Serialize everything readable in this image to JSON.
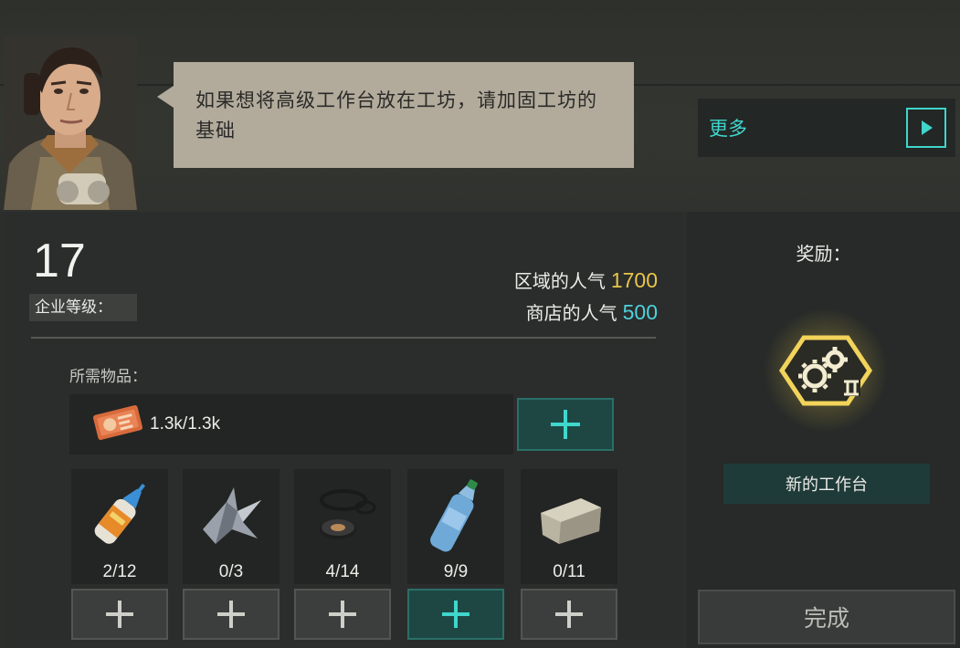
{
  "npc": {
    "dialog": "如果想将高级工作台放在工坊，请加固工坊的基础"
  },
  "more": {
    "label": "更多"
  },
  "level": {
    "value": "17",
    "label": "企业等级："
  },
  "popularity": {
    "region_label": "区域的人气",
    "region_value": "1700",
    "shop_label": "商店的人气",
    "shop_value": "500",
    "region_color": "#e9c54a",
    "shop_color": "#4fd1dc"
  },
  "requirements": {
    "label": "所需物品：",
    "money": {
      "icon": "money-voucher-icon",
      "amount": "1.3k/1.3k"
    },
    "items": [
      {
        "icon": "glue-icon",
        "count": "2/12"
      },
      {
        "icon": "scrap-metal-icon",
        "count": "0/3"
      },
      {
        "icon": "rubber-seal-icon",
        "count": "4/14"
      },
      {
        "icon": "water-bottle-icon",
        "count": "9/9"
      },
      {
        "icon": "stone-block-icon",
        "count": "0/11"
      }
    ]
  },
  "reward": {
    "title": "奖励：",
    "icon": "workbench-gears-icon",
    "name": "新的工作台"
  },
  "complete": {
    "label": "完成"
  },
  "colors": {
    "accent": "#3fd6cc",
    "active_button": "#1e4744"
  }
}
